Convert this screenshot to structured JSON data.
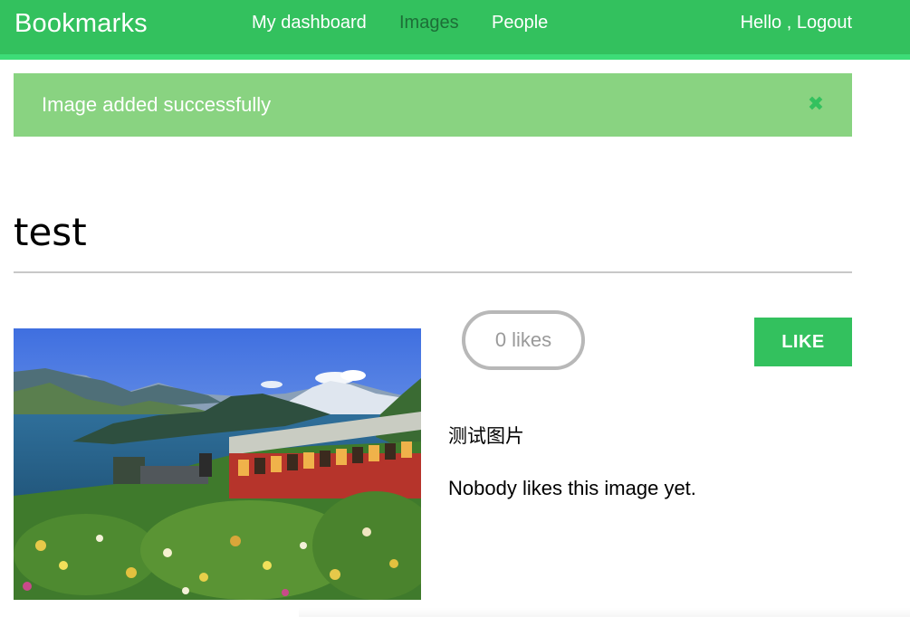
{
  "header": {
    "logo": "Bookmarks",
    "nav": [
      {
        "label": "My dashboard",
        "active": false
      },
      {
        "label": "Images",
        "active": true
      },
      {
        "label": "People",
        "active": false
      }
    ],
    "greeting": "Hello , ",
    "logout_label": "Logout"
  },
  "alert": {
    "message": "Image added successfully",
    "close_icon": "✖"
  },
  "image": {
    "title": "test",
    "likes_label": "0 likes",
    "like_button": "LIKE",
    "description": "测试图片",
    "no_likes_text": "Nobody likes this image yet."
  },
  "colors": {
    "brand": "#33c15e",
    "alert_bg": "#89d381",
    "active_nav": "#1d6e37"
  }
}
